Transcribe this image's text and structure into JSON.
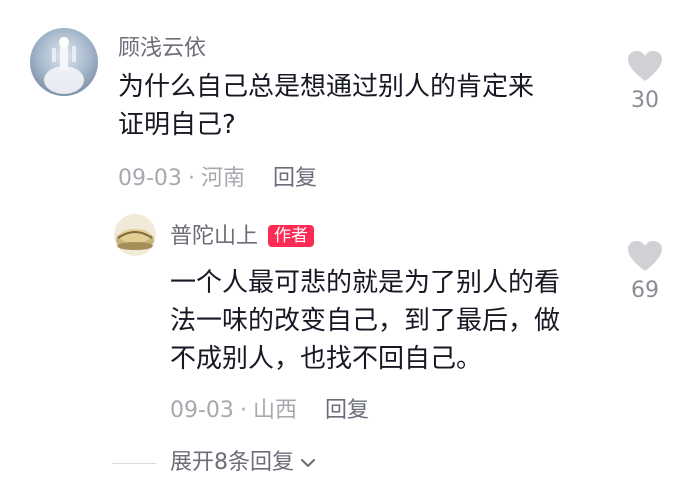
{
  "comment1": {
    "username": "顾浅云依",
    "content_lines": [
      "为什么自己总是想通过别人的肯定来",
      "证明自己?"
    ],
    "date": "09-03",
    "location": "河南",
    "reply_label": "回复",
    "like_count": "30",
    "avatar_icon": "avatar-statue-icon"
  },
  "reply1": {
    "username": "普陀山上",
    "badge": "作者",
    "content_lines": [
      "一个人最可悲的就是为了别人的看",
      "法一味的改变自己，到了最后，做",
      "不成别人，也找不回自己。"
    ],
    "date": "09-03",
    "location": "山西",
    "reply_label": "回复",
    "like_count": "69",
    "avatar_icon": "avatar-mountain-icon"
  },
  "expand": {
    "label": "展开8条回复",
    "icon": "chevron-down-icon"
  },
  "colors": {
    "text_primary": "#161823",
    "text_secondary": "#6b6e78",
    "text_meta": "#a6a8ae",
    "heart": "#d0d1d5",
    "badge": "#fe2c55"
  }
}
